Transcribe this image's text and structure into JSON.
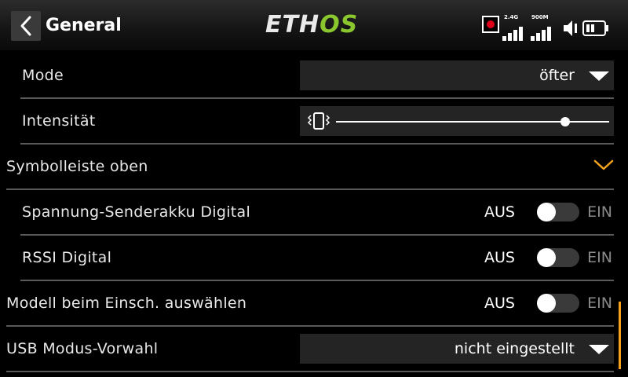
{
  "header": {
    "title": "General",
    "logo_part1": "ETH",
    "logo_part2": "OS",
    "logo_colors": {
      "light": "#eaeaea",
      "accent": "#8ac62e"
    },
    "band_24": "2.4G",
    "band_900": "900M",
    "icons": [
      "back-chevron-icon",
      "record-icon",
      "signal-24g-icon",
      "signal-900m-icon",
      "volume-mute-icon",
      "battery-icon"
    ]
  },
  "rows": [
    {
      "label": "Mode",
      "type": "dropdown",
      "value": "öfter"
    },
    {
      "label": "Intensität",
      "type": "slider",
      "value_fraction": 0.84,
      "icon": "vibration-icon"
    },
    {
      "label": "Symbolleiste oben",
      "type": "section",
      "icon": "chevron-down-icon"
    },
    {
      "label": "Spannung-Senderakku Digital",
      "type": "toggle",
      "off_label": "AUS",
      "on_label": "EIN",
      "state": "off"
    },
    {
      "label": "RSSI Digital",
      "type": "toggle",
      "off_label": "AUS",
      "on_label": "EIN",
      "state": "off"
    },
    {
      "label": "Modell beim Einsch. auswählen",
      "type": "toggle",
      "off_label": "AUS",
      "on_label": "EIN",
      "state": "off"
    },
    {
      "label": "USB Modus-Vorwahl",
      "type": "dropdown",
      "value": "nicht eingestellt"
    }
  ],
  "colors": {
    "accent": "#f4a21c",
    "background": "#000000",
    "control_bg": "#242424",
    "record": "#e0001a"
  }
}
